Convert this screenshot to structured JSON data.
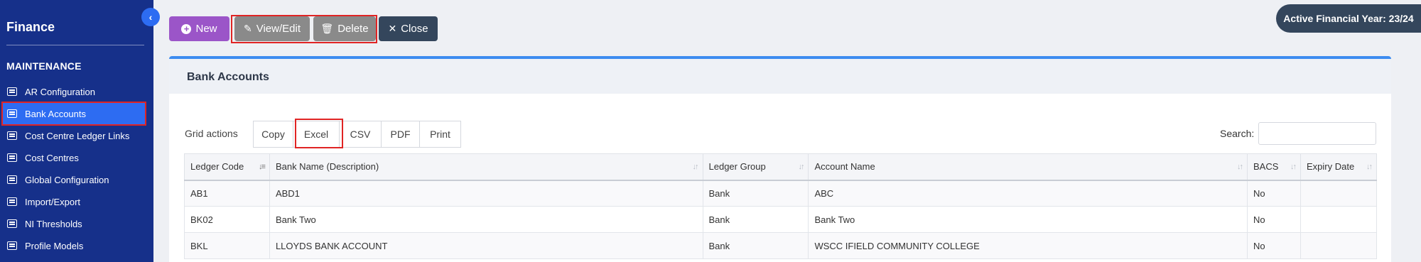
{
  "sidebar": {
    "title": "Finance",
    "section": "MAINTENANCE",
    "items": [
      {
        "label": "AR Configuration"
      },
      {
        "label": "Bank Accounts"
      },
      {
        "label": "Cost Centre Ledger Links"
      },
      {
        "label": "Cost Centres"
      },
      {
        "label": "Global Configuration"
      },
      {
        "label": "Import/Export"
      },
      {
        "label": "NI Thresholds"
      },
      {
        "label": "Profile Models"
      }
    ],
    "active_item": "Bank Accounts"
  },
  "toolbar": {
    "new_label": "New",
    "view_edit_label": "View/Edit",
    "delete_label": "Delete",
    "close_label": "Close"
  },
  "financial_year": "Active Financial Year: 23/24",
  "card": {
    "title": "Bank Accounts"
  },
  "grid_actions": {
    "label": "Grid actions",
    "buttons": [
      "Copy",
      "Excel",
      "CSV",
      "PDF",
      "Print"
    ]
  },
  "search": {
    "label": "Search:",
    "value": ""
  },
  "table": {
    "columns": [
      "Ledger Code",
      "Bank Name (Description)",
      "Ledger Group",
      "Account Name",
      "BACS",
      "Expiry Date"
    ],
    "rows": [
      [
        "AB1",
        "ABD1",
        "Bank",
        "ABC",
        "No",
        ""
      ],
      [
        "BK02",
        "Bank Two",
        "Bank",
        "Bank Two",
        "No",
        ""
      ],
      [
        "BKL",
        "LLOYDS BANK ACCOUNT",
        "Bank",
        "WSCC IFIELD COMMUNITY COLLEGE",
        "No",
        ""
      ]
    ]
  },
  "colors": {
    "sidebar_bg": "#16308a",
    "active_item": "#2d6cf2",
    "new_button": "#9b55c8",
    "highlight": "#e02424",
    "card_accent": "#3d8cf0"
  }
}
